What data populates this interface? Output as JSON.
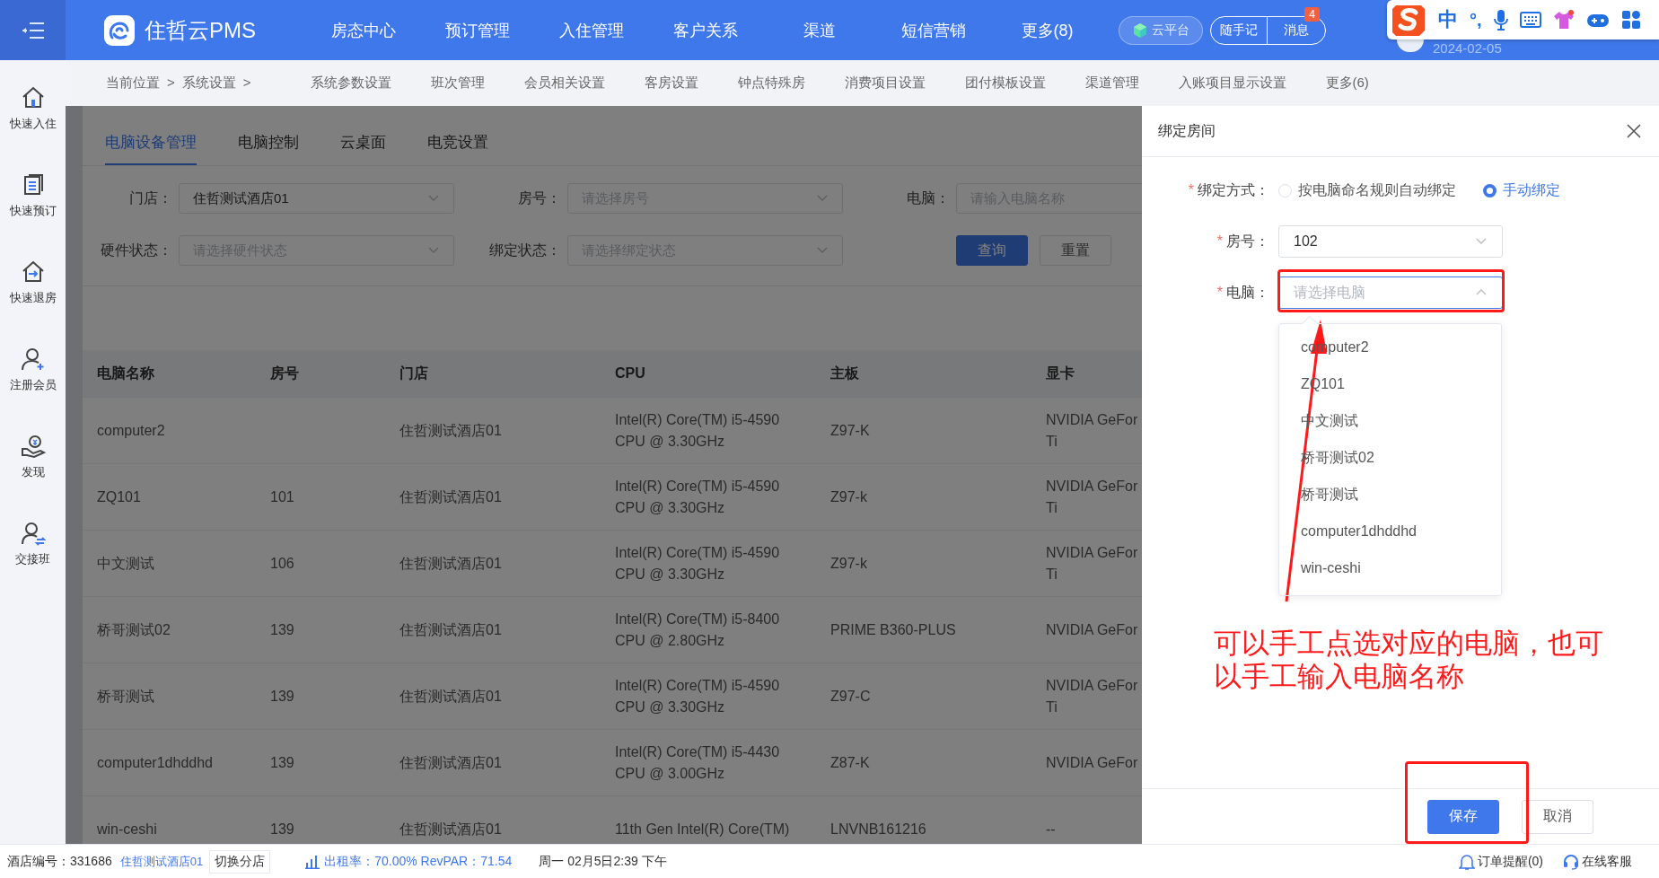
{
  "top_bar": {
    "brand": "住哲云PMS",
    "nav": [
      {
        "label": "房态中心"
      },
      {
        "label": "预订管理"
      },
      {
        "label": "入住管理"
      },
      {
        "label": "客户关系"
      },
      {
        "label": "渠道"
      },
      {
        "label": "短信营销"
      },
      {
        "label": "更多(8)"
      }
    ],
    "cloud_button": "云平台",
    "note_button": "随手记",
    "message_button": "消息",
    "message_badge": "4",
    "date": "2024-02-05"
  },
  "ime_toolbar": {
    "mode": "中",
    "punctuation": "°,"
  },
  "sidebar": {
    "items": [
      {
        "label": "快速入住"
      },
      {
        "label": "快速预订"
      },
      {
        "label": "快速退房"
      },
      {
        "label": "注册会员"
      },
      {
        "label": "发现"
      },
      {
        "label": "交接班"
      }
    ]
  },
  "breadcrumb": [
    "当前位置",
    ">",
    "系统设置",
    ">"
  ],
  "settings_menu": [
    "系统参数设置",
    "班次管理",
    "会员相关设置",
    "客房设置",
    "钟点特殊房",
    "消费项目设置",
    "团付模板设置",
    "渠道管理",
    "入账项目显示设置",
    "更多(6)"
  ],
  "tabs": [
    {
      "label": "电脑设备管理",
      "selected": true
    },
    {
      "label": "电脑控制",
      "selected": false
    },
    {
      "label": "云桌面",
      "selected": false
    },
    {
      "label": "电竞设置",
      "selected": false
    }
  ],
  "filters": [
    {
      "kind": "select",
      "label": "门店：",
      "value": "住哲测试酒店01"
    },
    {
      "kind": "select",
      "label": "房号：",
      "placeholder": "请选择房号"
    },
    {
      "kind": "input",
      "label": "电脑：",
      "placeholder": "请输入电脑名称"
    },
    {
      "kind": "select",
      "label": "硬件状态：",
      "placeholder": "请选择硬件状态"
    },
    {
      "kind": "select",
      "label": "绑定状态：",
      "placeholder": "请选择绑定状态"
    }
  ],
  "filter_buttons": [
    {
      "kind": "primary",
      "label": "查询"
    },
    {
      "kind": "default",
      "label": "重置"
    }
  ],
  "table": {
    "columns": [
      "电脑名称",
      "房号",
      "门店",
      "CPU",
      "主板",
      "显卡"
    ],
    "rows": [
      [
        "computer2",
        "",
        "住哲测试酒店01",
        "Intel(R) Core(TM) i5-4590 CPU @ 3.30GHz",
        "Z97-K",
        "NVIDIA GeFor\nTi"
      ],
      [
        "ZQ101",
        "101",
        "住哲测试酒店01",
        "Intel(R) Core(TM) i5-4590 CPU @ 3.30GHz",
        "Z97-k",
        "NVIDIA GeFor\nTi"
      ],
      [
        "中文测试",
        "106",
        "住哲测试酒店01",
        "Intel(R) Core(TM) i5-4590 CPU @ 3.30GHz",
        "Z97-k",
        "NVIDIA GeFor\nTi"
      ],
      [
        "桥哥测试02",
        "139",
        "住哲测试酒店01",
        "Intel(R) Core(TM) i5-8400 CPU @ 2.80GHz",
        "PRIME B360-PLUS",
        "NVIDIA GeFor"
      ],
      [
        "桥哥测试",
        "139",
        "住哲测试酒店01",
        "Intel(R) Core(TM) i5-4590 CPU @ 3.30GHz",
        "Z97-C",
        "NVIDIA GeFor\nTi"
      ],
      [
        "computer1dhddhd",
        "139",
        "住哲测试酒店01",
        "Intel(R) Core(TM) i5-4430 CPU @ 3.00GHz",
        "Z87-K",
        "NVIDIA GeFor"
      ],
      [
        "win-ceshi",
        "139",
        "住哲测试酒店01",
        "11th Gen Intel(R) Core(TM)",
        "LNVNB161216",
        "--"
      ]
    ]
  },
  "drawer": {
    "title": "绑定房间",
    "required_mark": "*",
    "fields": [
      {
        "kind": "radio",
        "label": "绑定方式：",
        "required": true,
        "options": [
          {
            "label": "按电脑命名规则自动绑定",
            "selected": false
          },
          {
            "label": "手动绑定",
            "selected": true
          }
        ]
      },
      {
        "kind": "select",
        "label": "房号：",
        "required": true,
        "value": "102",
        "expanded": false
      },
      {
        "kind": "select",
        "label": "电脑：",
        "required": true,
        "placeholder": "请选择电脑",
        "expanded": true
      }
    ],
    "dropdown_options": [
      "computer2",
      "ZQ101",
      "中文测试",
      "桥哥测试02",
      "桥哥测试",
      "computer1dhddhd",
      "win-ceshi"
    ],
    "buttons": [
      {
        "kind": "primary",
        "label": "保存"
      },
      {
        "kind": "default",
        "label": "取消"
      }
    ]
  },
  "annotation": "可以手工点选对应的电脑，也可以手工输入电脑名称",
  "status_bar": {
    "hotel_id": "酒店编号：331686",
    "hotel_name": "住哲测试酒店01",
    "switch_button": "切换分店",
    "occupancy": "出租率：70.00% RevPAR：71.54",
    "datetime": "周一 02月5日2:39 下午",
    "order_alert": "订单提醒(0)",
    "support": "在线客服"
  }
}
